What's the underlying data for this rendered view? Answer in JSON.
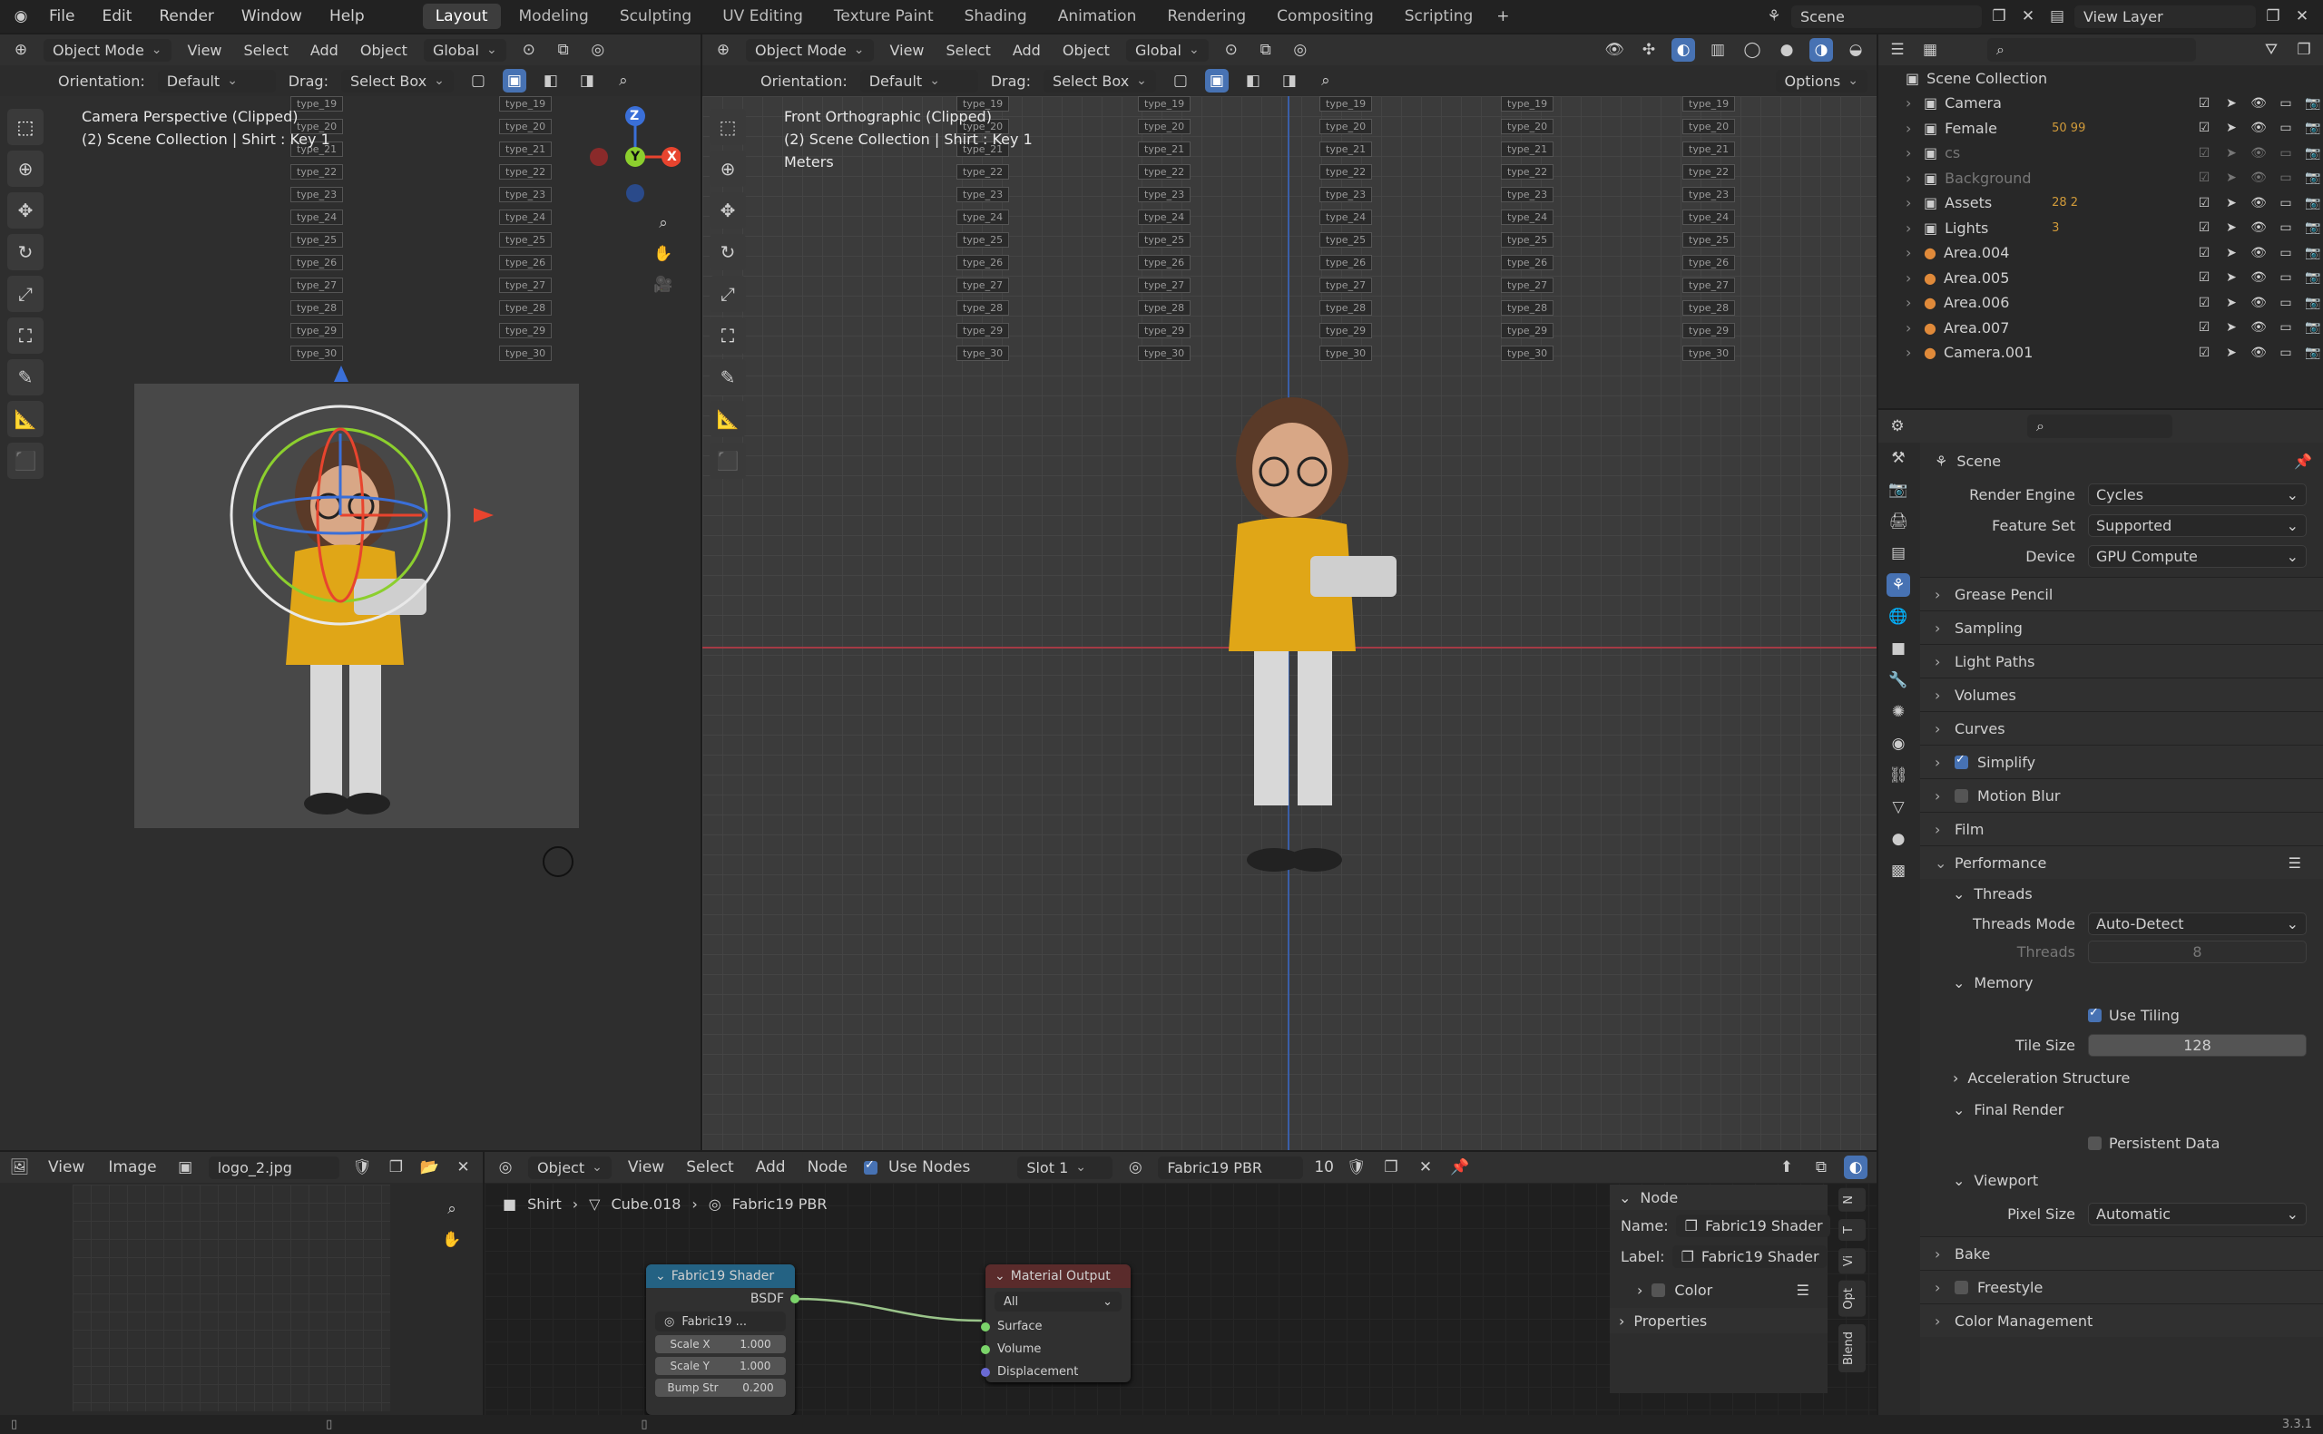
{
  "topbar": {
    "menus": [
      "File",
      "Edit",
      "Render",
      "Window",
      "Help"
    ],
    "workspaces": [
      "Layout",
      "Modeling",
      "Sculpting",
      "UV Editing",
      "Texture Paint",
      "Shading",
      "Animation",
      "Rendering",
      "Compositing",
      "Scripting"
    ],
    "active_workspace": "Layout",
    "scene": "Scene",
    "view_layer": "View Layer"
  },
  "vp1": {
    "mode": "Object Mode",
    "menus": [
      "View",
      "Select",
      "Add",
      "Object"
    ],
    "transform": "Global",
    "orientation_label": "Orientation:",
    "orientation": "Default",
    "drag_label": "Drag:",
    "drag": "Select Box",
    "overlay_line1": "Camera Perspective (Clipped)",
    "overlay_line2": "(2) Scene Collection | Shirt : Key 1",
    "axis_x": "X",
    "axis_y": "Y",
    "axis_z": "Z"
  },
  "vp2": {
    "mode": "Object Mode",
    "menus": [
      "View",
      "Select",
      "Add",
      "Object"
    ],
    "transform": "Global",
    "orientation_label": "Orientation:",
    "orientation": "Default",
    "drag_label": "Drag:",
    "drag": "Select Box",
    "options": "Options",
    "overlay_line1": "Front Orthographic (Clipped)",
    "overlay_line2": "(2) Scene Collection | Shirt : Key 1",
    "overlay_line3": "Meters"
  },
  "outliner": {
    "root": "Scene Collection",
    "items": [
      {
        "name": "Camera",
        "extra": "",
        "dim": false
      },
      {
        "name": "Female",
        "extra": "50  99",
        "dim": false
      },
      {
        "name": "cs",
        "extra": "",
        "dim": true
      },
      {
        "name": "Background",
        "extra": "",
        "dim": true
      },
      {
        "name": "Assets",
        "extra": "28  2",
        "dim": false
      },
      {
        "name": "Lights",
        "extra": "3",
        "dim": false
      },
      {
        "name": "Area.004",
        "extra": "",
        "dim": false
      },
      {
        "name": "Area.005",
        "extra": "",
        "dim": false
      },
      {
        "name": "Area.006",
        "extra": "",
        "dim": false
      },
      {
        "name": "Area.007",
        "extra": "",
        "dim": false
      },
      {
        "name": "Camera.001",
        "extra": "",
        "dim": false
      }
    ]
  },
  "props": {
    "context": "Scene",
    "render_engine_label": "Render Engine",
    "render_engine": "Cycles",
    "feature_set_label": "Feature Set",
    "feature_set": "Supported",
    "device_label": "Device",
    "device": "GPU Compute",
    "sections_top": [
      "Grease Pencil",
      "Sampling",
      "Light Paths",
      "Volumes",
      "Curves",
      "Simplify",
      "Motion Blur",
      "Film"
    ],
    "performance": "Performance",
    "threads": "Threads",
    "threads_mode_label": "Threads Mode",
    "threads_mode": "Auto-Detect",
    "threads_label": "Threads",
    "threads_value": "8",
    "memory": "Memory",
    "use_tiling": "Use Tiling",
    "tile_size_label": "Tile Size",
    "tile_size": "128",
    "accel": "Acceleration Structure",
    "final_render": "Final Render",
    "persistent": "Persistent Data",
    "viewport": "Viewport",
    "pixel_size_label": "Pixel Size",
    "pixel_size": "Automatic",
    "sections_bottom": [
      "Bake",
      "Freestyle",
      "Color Management"
    ]
  },
  "image_editor": {
    "menus": [
      "View",
      "Image"
    ],
    "image": "logo_2.jpg"
  },
  "node_editor": {
    "mode": "Object",
    "menus": [
      "View",
      "Select",
      "Add",
      "Node"
    ],
    "use_nodes": "Use Nodes",
    "slot": "Slot 1",
    "material": "Fabric19 PBR",
    "users": "10",
    "breadcrumb": [
      "Shirt",
      "Cube.018",
      "Fabric19 PBR"
    ],
    "shader_node": {
      "title": "Fabric19 Shader",
      "out": "BSDF",
      "group": "Fabric19 ...",
      "inputs": [
        {
          "name": "Scale X",
          "value": "1.000"
        },
        {
          "name": "Scale Y",
          "value": "1.000"
        },
        {
          "name": "Bump Str",
          "value": "0.200"
        }
      ]
    },
    "output_node": {
      "title": "Material Output",
      "target": "All",
      "inputs": [
        "Surface",
        "Volume",
        "Displacement"
      ]
    },
    "sidebar": {
      "section": "Node",
      "name_label": "Name:",
      "name": "Fabric19 Shader",
      "label_label": "Label:",
      "label": "Fabric19 Shader",
      "color": "Color",
      "properties": "Properties",
      "tabs": [
        "N",
        "T",
        "Vi",
        "Opt",
        "Blend"
      ]
    }
  },
  "statusbar": {
    "version": "3.3.1"
  },
  "colors": {
    "accent": "#4772b3",
    "shader_header": "#246283",
    "output_header": "#5a2b2b"
  },
  "bg_labels": [
    "type_19",
    "type_20",
    "type_21",
    "type_22",
    "type_23",
    "type_24",
    "type_25",
    "type_26",
    "type_27",
    "type_28",
    "type_29",
    "type_30"
  ]
}
